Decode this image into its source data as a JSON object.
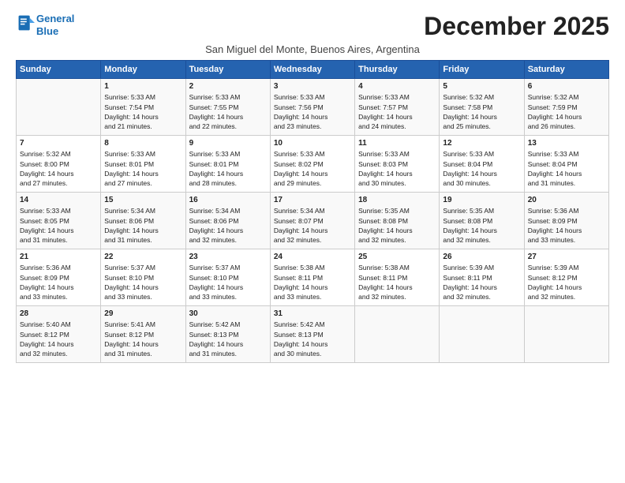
{
  "header": {
    "logo_line1": "General",
    "logo_line2": "Blue",
    "title": "December 2025",
    "subtitle": "San Miguel del Monte, Buenos Aires, Argentina"
  },
  "columns": [
    "Sunday",
    "Monday",
    "Tuesday",
    "Wednesday",
    "Thursday",
    "Friday",
    "Saturday"
  ],
  "weeks": [
    [
      {
        "day": "",
        "info": ""
      },
      {
        "day": "1",
        "info": "Sunrise: 5:33 AM\nSunset: 7:54 PM\nDaylight: 14 hours\nand 21 minutes."
      },
      {
        "day": "2",
        "info": "Sunrise: 5:33 AM\nSunset: 7:55 PM\nDaylight: 14 hours\nand 22 minutes."
      },
      {
        "day": "3",
        "info": "Sunrise: 5:33 AM\nSunset: 7:56 PM\nDaylight: 14 hours\nand 23 minutes."
      },
      {
        "day": "4",
        "info": "Sunrise: 5:33 AM\nSunset: 7:57 PM\nDaylight: 14 hours\nand 24 minutes."
      },
      {
        "day": "5",
        "info": "Sunrise: 5:32 AM\nSunset: 7:58 PM\nDaylight: 14 hours\nand 25 minutes."
      },
      {
        "day": "6",
        "info": "Sunrise: 5:32 AM\nSunset: 7:59 PM\nDaylight: 14 hours\nand 26 minutes."
      }
    ],
    [
      {
        "day": "7",
        "info": "Sunrise: 5:32 AM\nSunset: 8:00 PM\nDaylight: 14 hours\nand 27 minutes."
      },
      {
        "day": "8",
        "info": "Sunrise: 5:33 AM\nSunset: 8:01 PM\nDaylight: 14 hours\nand 27 minutes."
      },
      {
        "day": "9",
        "info": "Sunrise: 5:33 AM\nSunset: 8:01 PM\nDaylight: 14 hours\nand 28 minutes."
      },
      {
        "day": "10",
        "info": "Sunrise: 5:33 AM\nSunset: 8:02 PM\nDaylight: 14 hours\nand 29 minutes."
      },
      {
        "day": "11",
        "info": "Sunrise: 5:33 AM\nSunset: 8:03 PM\nDaylight: 14 hours\nand 30 minutes."
      },
      {
        "day": "12",
        "info": "Sunrise: 5:33 AM\nSunset: 8:04 PM\nDaylight: 14 hours\nand 30 minutes."
      },
      {
        "day": "13",
        "info": "Sunrise: 5:33 AM\nSunset: 8:04 PM\nDaylight: 14 hours\nand 31 minutes."
      }
    ],
    [
      {
        "day": "14",
        "info": "Sunrise: 5:33 AM\nSunset: 8:05 PM\nDaylight: 14 hours\nand 31 minutes."
      },
      {
        "day": "15",
        "info": "Sunrise: 5:34 AM\nSunset: 8:06 PM\nDaylight: 14 hours\nand 31 minutes."
      },
      {
        "day": "16",
        "info": "Sunrise: 5:34 AM\nSunset: 8:06 PM\nDaylight: 14 hours\nand 32 minutes."
      },
      {
        "day": "17",
        "info": "Sunrise: 5:34 AM\nSunset: 8:07 PM\nDaylight: 14 hours\nand 32 minutes."
      },
      {
        "day": "18",
        "info": "Sunrise: 5:35 AM\nSunset: 8:08 PM\nDaylight: 14 hours\nand 32 minutes."
      },
      {
        "day": "19",
        "info": "Sunrise: 5:35 AM\nSunset: 8:08 PM\nDaylight: 14 hours\nand 32 minutes."
      },
      {
        "day": "20",
        "info": "Sunrise: 5:36 AM\nSunset: 8:09 PM\nDaylight: 14 hours\nand 33 minutes."
      }
    ],
    [
      {
        "day": "21",
        "info": "Sunrise: 5:36 AM\nSunset: 8:09 PM\nDaylight: 14 hours\nand 33 minutes."
      },
      {
        "day": "22",
        "info": "Sunrise: 5:37 AM\nSunset: 8:10 PM\nDaylight: 14 hours\nand 33 minutes."
      },
      {
        "day": "23",
        "info": "Sunrise: 5:37 AM\nSunset: 8:10 PM\nDaylight: 14 hours\nand 33 minutes."
      },
      {
        "day": "24",
        "info": "Sunrise: 5:38 AM\nSunset: 8:11 PM\nDaylight: 14 hours\nand 33 minutes."
      },
      {
        "day": "25",
        "info": "Sunrise: 5:38 AM\nSunset: 8:11 PM\nDaylight: 14 hours\nand 32 minutes."
      },
      {
        "day": "26",
        "info": "Sunrise: 5:39 AM\nSunset: 8:11 PM\nDaylight: 14 hours\nand 32 minutes."
      },
      {
        "day": "27",
        "info": "Sunrise: 5:39 AM\nSunset: 8:12 PM\nDaylight: 14 hours\nand 32 minutes."
      }
    ],
    [
      {
        "day": "28",
        "info": "Sunrise: 5:40 AM\nSunset: 8:12 PM\nDaylight: 14 hours\nand 32 minutes."
      },
      {
        "day": "29",
        "info": "Sunrise: 5:41 AM\nSunset: 8:12 PM\nDaylight: 14 hours\nand 31 minutes."
      },
      {
        "day": "30",
        "info": "Sunrise: 5:42 AM\nSunset: 8:13 PM\nDaylight: 14 hours\nand 31 minutes."
      },
      {
        "day": "31",
        "info": "Sunrise: 5:42 AM\nSunset: 8:13 PM\nDaylight: 14 hours\nand 30 minutes."
      },
      {
        "day": "",
        "info": ""
      },
      {
        "day": "",
        "info": ""
      },
      {
        "day": "",
        "info": ""
      }
    ]
  ]
}
